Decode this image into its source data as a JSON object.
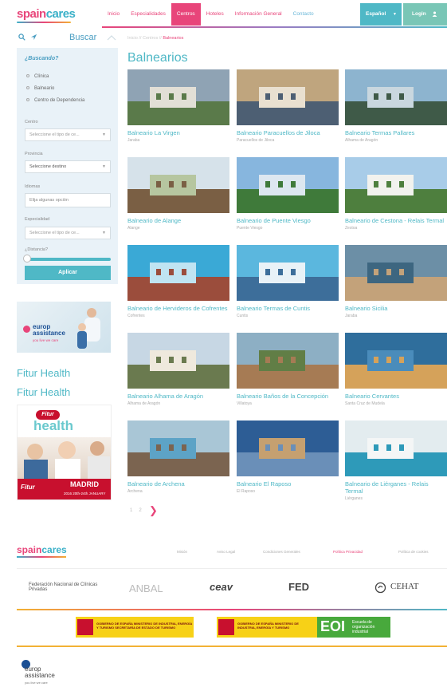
{
  "header": {
    "logo_a": "spain",
    "logo_b": "cares",
    "nav": [
      "Inicio",
      "Especialidades",
      "Centros",
      "Hoteles",
      "Información General",
      "Contacto"
    ],
    "lang": "Español",
    "login": "Login"
  },
  "search": {
    "label": "Buscar"
  },
  "breadcrumb": {
    "a": "Inicio",
    "sep1": "//",
    "b": "Centros",
    "sep2": "//",
    "c": "Balnearios"
  },
  "filter": {
    "title": "¿Buscando?",
    "options": [
      "Clínica",
      "Balneario",
      "Centro de Dependencia"
    ],
    "centro_label": "Centro",
    "centro_value": "Seleccione el tipo de ce...",
    "provincia_label": "Provincia",
    "provincia_value": "Seleccione destino",
    "idiomas_label": "Idiomas",
    "idiomas_value": "Elija algunas opción",
    "especialidad_label": "Especialidad",
    "especialidad_value": "Seleccione el tipo de ce...",
    "distancia_label": "¿Distancia?",
    "distancia_level": 0.0,
    "apply": "Aplicar"
  },
  "ads": {
    "europ_a": "europ",
    "europ_b": "assistance",
    "europ_tag": "you live we care",
    "fitur_link_1": "Fitur Health",
    "fitur_link_2": "Fitur Health",
    "fitur_logo": "Fitur",
    "fitur_health": "health",
    "fitur_left": "Fitur",
    "fitur_city": "MADRID",
    "fitur_dates": "2016 20th-24th JANUARY"
  },
  "main": {
    "title": "Balnearios",
    "cards": [
      {
        "title": "Balneario La Virgen",
        "loc": "Jaraba"
      },
      {
        "title": "Balneario Paracuellos de Jiloca",
        "loc": "Paracuellos de Jiloca"
      },
      {
        "title": "Balneario Termas Pallares",
        "loc": "Alhama de Aragón"
      },
      {
        "title": "Balneario de Alange",
        "loc": "Alange"
      },
      {
        "title": "Balneario de Puente Viesgo",
        "loc": "Puente Viesgo"
      },
      {
        "title": "Balneario de Cestona - Relais Termal",
        "loc": "Zestoa"
      },
      {
        "title": "Balneario de Hervideros de Cofrentes",
        "loc": "Cofrentes"
      },
      {
        "title": "Balneario Termas de Cuntis",
        "loc": "Cuntis"
      },
      {
        "title": "Balneario Sicilia",
        "loc": "Jaraba"
      },
      {
        "title": "Balneario Alhama de Aragón",
        "loc": "Alhama de Aragón"
      },
      {
        "title": "Balneario Baños de la Concepción",
        "loc": "Villatoya"
      },
      {
        "title": "Balneario Cervantes",
        "loc": "Santa Cruz de Mudela"
      },
      {
        "title": "Balneario de Archena",
        "loc": "Archena"
      },
      {
        "title": "Balneario El Raposo",
        "loc": "El Raposo"
      },
      {
        "title": "Balneario de Liérganes - Relais Termal",
        "loc": "Liérganes"
      }
    ],
    "pager": [
      "1",
      "2"
    ]
  },
  "footer": {
    "logo_a": "spain",
    "logo_b": "cares",
    "links": [
      "Misión",
      "Aviso Legal",
      "Condiciones Generales",
      "Política Privacidad",
      "Política de cookies"
    ],
    "partners": {
      "fed_clinicas": "Federación Nacional de Clínicas Privadas",
      "anbal": "ANBAL",
      "ceav": "ceav",
      "fed": "FED",
      "cehat": "CEHAT"
    },
    "gov1": "GOBIERNO DE ESPAÑA  MINISTERIO DE INDUSTRIA, ENERGÍA Y TURISMO  SECRETARÍA DE ESTADO DE TURISMO",
    "gov2": "GOBIERNO DE ESPAÑA  MINISTERIO DE INDUSTRIA, ENERGÍA Y TURISMO",
    "eoi_logo": "EOI",
    "eoi_text": "Escuela de organización industrial",
    "europ_a": "europ",
    "europ_b": "assistance",
    "europ_tag": "you live we care"
  },
  "colors": {
    "pink": "#e8457a",
    "teal": "#4fb8c6",
    "panel": "#e9f2f8"
  }
}
